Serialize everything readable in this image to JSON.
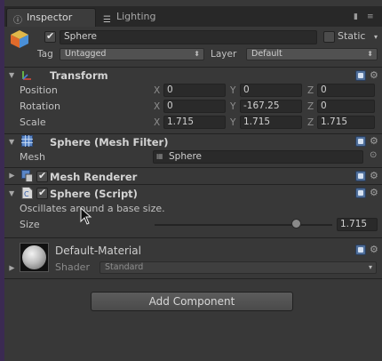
{
  "tabs": [
    {
      "label": "Inspector",
      "icon": "info-icon",
      "active": true
    },
    {
      "label": "Lighting",
      "icon": "lighting-icon",
      "active": false
    }
  ],
  "game_object": {
    "active": true,
    "name": "Sphere",
    "static_label": "Static",
    "static_checked": false,
    "tag_label": "Tag",
    "tag_value": "Untagged",
    "layer_label": "Layer",
    "layer_value": "Default"
  },
  "transform": {
    "title": "Transform",
    "rows": [
      {
        "label": "Position",
        "x": "0",
        "y": "0",
        "z": "0"
      },
      {
        "label": "Rotation",
        "x": "0",
        "y": "-167.25",
        "z": "0"
      },
      {
        "label": "Scale",
        "x": "1.715",
        "y": "1.715",
        "z": "1.715"
      }
    ],
    "axis_labels": [
      "X",
      "Y",
      "Z"
    ]
  },
  "mesh_filter": {
    "title": "Sphere (Mesh Filter)",
    "mesh_label": "Mesh",
    "mesh_value": "Sphere"
  },
  "mesh_renderer": {
    "title": "Mesh Renderer",
    "enabled": true
  },
  "script": {
    "title": "Sphere (Script)",
    "enabled": true,
    "description": "Oscillates around a base size.",
    "size_label": "Size",
    "size_value": "1.715",
    "slider_fraction": 0.8
  },
  "material": {
    "name": "Default-Material",
    "shader_label": "Shader",
    "shader_value": "Standard"
  },
  "add_component_label": "Add Component",
  "colors": {
    "background": "#383838",
    "tab_bar": "#282828",
    "field": "#2a2a2a",
    "text": "#c2c2c2",
    "help_icon": "#4f6f9b"
  }
}
